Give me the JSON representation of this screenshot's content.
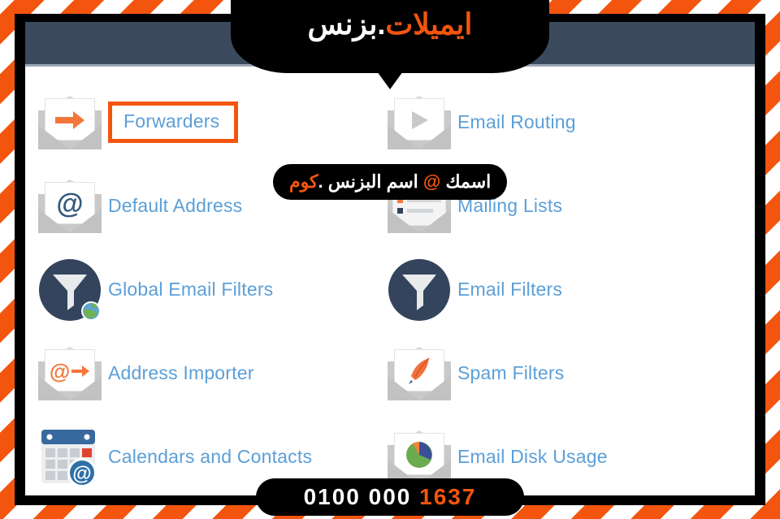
{
  "brand": {
    "logo_orange": "ايميلات",
    "logo_white": ".بزنس",
    "accent_color": "#f4550e",
    "link_color": "#5b9fd8",
    "header_color": "#3a4a5c"
  },
  "callout": {
    "part1": "اسمك ",
    "at": "@",
    "part2": " اسم البزنس .",
    "part3": "كوم"
  },
  "phone": {
    "prefix": "0100 000",
    "suffix": "1637"
  },
  "email_section": {
    "left_column": [
      {
        "label": "Forwarders",
        "icon": "envelope-arrow-icon",
        "highlighted": true
      },
      {
        "label": "Default Address",
        "icon": "envelope-at-icon",
        "highlighted": false
      },
      {
        "label": "Global Email Filters",
        "icon": "funnel-globe-icon",
        "highlighted": false
      },
      {
        "label": "Address Importer",
        "icon": "envelope-at-arrow-icon",
        "highlighted": false
      },
      {
        "label": "Calendars and Contacts",
        "icon": "calendar-at-icon",
        "highlighted": false
      }
    ],
    "right_column": [
      {
        "label": "Email Routing",
        "icon": "envelope-play-icon",
        "highlighted": false
      },
      {
        "label": "Mailing Lists",
        "icon": "envelope-list-icon",
        "highlighted": false
      },
      {
        "label": "Email Filters",
        "icon": "funnel-icon",
        "highlighted": false
      },
      {
        "label": "Spam Filters",
        "icon": "envelope-quill-icon",
        "highlighted": false
      },
      {
        "label": "Email Disk Usage",
        "icon": "envelope-pie-icon",
        "highlighted": false
      }
    ]
  }
}
